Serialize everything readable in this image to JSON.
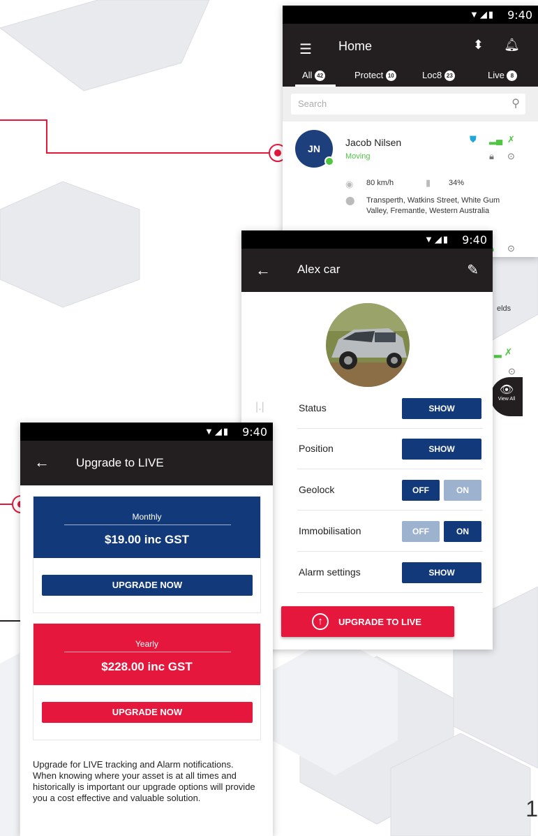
{
  "colors": {
    "brand_blue": "#12397a",
    "brand_red": "#e5173c",
    "appbar": "#231f20",
    "moving_green": "#4fc542"
  },
  "home": {
    "status_time": "9:40",
    "title": "Home",
    "tabs": [
      {
        "label": "All",
        "count": "42"
      },
      {
        "label": "Protect",
        "count": "10"
      },
      {
        "label": "Loc8",
        "count": "23"
      },
      {
        "label": "Live",
        "count": "8"
      }
    ],
    "search_placeholder": "Search",
    "card": {
      "initials": "JN",
      "name": "Jacob Nilsen",
      "status": "Moving",
      "speed": "80 km/h",
      "fuel": "34%",
      "address": "Transperth, Watkins Street, White Gum Valley, Fremantle, Western Australia"
    },
    "partial_text": "elds",
    "view_all": "View All"
  },
  "vehicle": {
    "status_time": "9:40",
    "title": "Alex car",
    "rows": [
      {
        "label": "Status",
        "button": "SHOW"
      },
      {
        "label": "Position",
        "button": "SHOW"
      },
      {
        "label": "Geolock",
        "off": "OFF",
        "on": "ON"
      },
      {
        "label": "Immobilisation",
        "off": "OFF",
        "on": "ON"
      },
      {
        "label": "Alarm settings",
        "button": "SHOW"
      }
    ],
    "upgrade_button": "UPGRADE TO LIVE"
  },
  "upgrade": {
    "status_time": "9:40",
    "title": "Upgrade to LIVE",
    "plans": [
      {
        "period": "Monthly",
        "price": "$19.00 inc GST",
        "button": "UPGRADE NOW"
      },
      {
        "period": "Yearly",
        "price": "$228.00 inc GST",
        "button": "UPGRADE NOW"
      }
    ],
    "note": "Upgrade for LIVE tracking and Alarm notifications. When knowing where your asset is at all times and historically is important our upgrade options will provide you a cost effective and valuable solution."
  },
  "page_number": "1"
}
